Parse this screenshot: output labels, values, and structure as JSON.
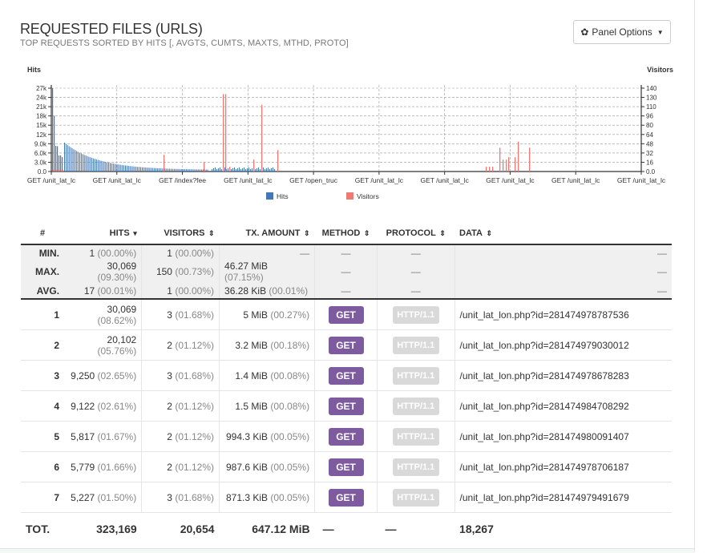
{
  "panel": {
    "title": "REQUESTED FILES (URLS)",
    "subtitle": "TOP REQUESTS SORTED BY HITS [, AVGTS, CUMTS, MAXTS, MTHD, PROTO]",
    "options_label": "Panel Options",
    "options_icon": "gear-icon",
    "options_caret_icon": "caret-down-icon"
  },
  "chart_data": {
    "type": "bar",
    "left_axis_label": "Hits",
    "right_axis_label": "Visitors",
    "left_ticks": [
      "27k",
      "24k",
      "21k",
      "18k",
      "15k",
      "12k",
      "9.0k",
      "6.0k",
      "3.0k",
      "0.0"
    ],
    "right_ticks": [
      "140",
      "130",
      "110",
      "96",
      "80",
      "64",
      "48",
      "32",
      "16",
      "0.0"
    ],
    "left_ylim": [
      0,
      30069
    ],
    "right_ylim": [
      0,
      150
    ],
    "categories": [
      "GET /unit_lat_lc",
      "GET /unit_lat_lc",
      "GET /index?fee",
      "GET /unit_lat_lc",
      "GET /open_truc",
      "GET /unit_lat_lc",
      "GET /unit_lat_lc",
      "GET /unit_lat_lc",
      "GET /unit_lat_lc",
      "GET /unit_lat_lc"
    ],
    "legend": [
      {
        "name": "Hits",
        "color": "#4477b6"
      },
      {
        "name": "Visitors",
        "color": "#ed7b73"
      }
    ],
    "grid": true,
    "series": [
      {
        "name": "Hits",
        "color": "#4477b6",
        "values": [
          30069,
          20102,
          9250,
          9122,
          5817,
          5779,
          5227
        ]
      },
      {
        "name": "Visitors",
        "color": "#ed7b73",
        "values": [
          3,
          2,
          3,
          2,
          2,
          2,
          3
        ]
      }
    ]
  },
  "table": {
    "headers": [
      {
        "label": "#",
        "icon": ""
      },
      {
        "label": "HITS",
        "icon": "▾"
      },
      {
        "label": "VISITORS",
        "icon": "⇕"
      },
      {
        "label": "TX. AMOUNT",
        "icon": "⇕"
      },
      {
        "label": "METHOD",
        "icon": "⇕"
      },
      {
        "label": "PROTOCOL",
        "icon": "⇕"
      },
      {
        "label": "DATA",
        "icon": "⇕"
      }
    ],
    "summary": [
      {
        "label": "MIN.",
        "hits": "1",
        "hits_pct": "(00.00%)",
        "visitors": "1",
        "visitors_pct": "(00.00%)",
        "tx": "—",
        "tx_pct": "",
        "method": "—",
        "protocol": "—",
        "data": "—"
      },
      {
        "label": "MAX.",
        "hits": "30,069",
        "hits_pct": "(09.30%)",
        "visitors": "150",
        "visitors_pct": "(00.73%)",
        "tx": "46.27 MiB",
        "tx_pct": "(07.15%)",
        "method": "—",
        "protocol": "—",
        "data": "—"
      },
      {
        "label": "AVG.",
        "hits": "17",
        "hits_pct": "(00.01%)",
        "visitors": "1",
        "visitors_pct": "(00.00%)",
        "tx": "36.28 KiB",
        "tx_pct": "(00.01%)",
        "method": "—",
        "protocol": "—",
        "data": "—"
      }
    ],
    "rows": [
      {
        "idx": "1",
        "hits": "30,069",
        "hits_pct": "(08.62%)",
        "visitors": "3",
        "visitors_pct": "(01.68%)",
        "tx": "5 MiB",
        "tx_pct": "(00.27%)",
        "method": "GET",
        "protocol": "HTTP/1.1",
        "data": "/unit_lat_lon.php?id=281474978787536"
      },
      {
        "idx": "2",
        "hits": "20,102",
        "hits_pct": "(05.76%)",
        "visitors": "2",
        "visitors_pct": "(01.12%)",
        "tx": "3.2 MiB",
        "tx_pct": "(00.18%)",
        "method": "GET",
        "protocol": "HTTP/1.1",
        "data": "/unit_lat_lon.php?id=281474979030012"
      },
      {
        "idx": "3",
        "hits": "9,250",
        "hits_pct": "(02.65%)",
        "visitors": "3",
        "visitors_pct": "(01.68%)",
        "tx": "1.4 MiB",
        "tx_pct": "(00.08%)",
        "method": "GET",
        "protocol": "HTTP/1.1",
        "data": "/unit_lat_lon.php?id=281474978678283"
      },
      {
        "idx": "4",
        "hits": "9,122",
        "hits_pct": "(02.61%)",
        "visitors": "2",
        "visitors_pct": "(01.12%)",
        "tx": "1.5 MiB",
        "tx_pct": "(00.08%)",
        "method": "GET",
        "protocol": "HTTP/1.1",
        "data": "/unit_lat_lon.php?id=281474984708292"
      },
      {
        "idx": "5",
        "hits": "5,817",
        "hits_pct": "(01.67%)",
        "visitors": "2",
        "visitors_pct": "(01.12%)",
        "tx": "994.3 KiB",
        "tx_pct": "(00.05%)",
        "method": "GET",
        "protocol": "HTTP/1.1",
        "data": "/unit_lat_lon.php?id=281474980091407"
      },
      {
        "idx": "6",
        "hits": "5,779",
        "hits_pct": "(01.66%)",
        "visitors": "2",
        "visitors_pct": "(01.12%)",
        "tx": "987.6 KiB",
        "tx_pct": "(00.05%)",
        "method": "GET",
        "protocol": "HTTP/1.1",
        "data": "/unit_lat_lon.php?id=281474978706187"
      },
      {
        "idx": "7",
        "hits": "5,227",
        "hits_pct": "(01.50%)",
        "visitors": "3",
        "visitors_pct": "(01.68%)",
        "tx": "871.3 KiB",
        "tx_pct": "(00.05%)",
        "method": "GET",
        "protocol": "HTTP/1.1",
        "data": "/unit_lat_lon.php?id=281474979491679"
      }
    ],
    "total": {
      "label": "TOT.",
      "hits": "323,169",
      "visitors": "20,654",
      "tx": "647.12 MiB",
      "method": "—",
      "protocol": "—",
      "data": "18,267"
    }
  }
}
